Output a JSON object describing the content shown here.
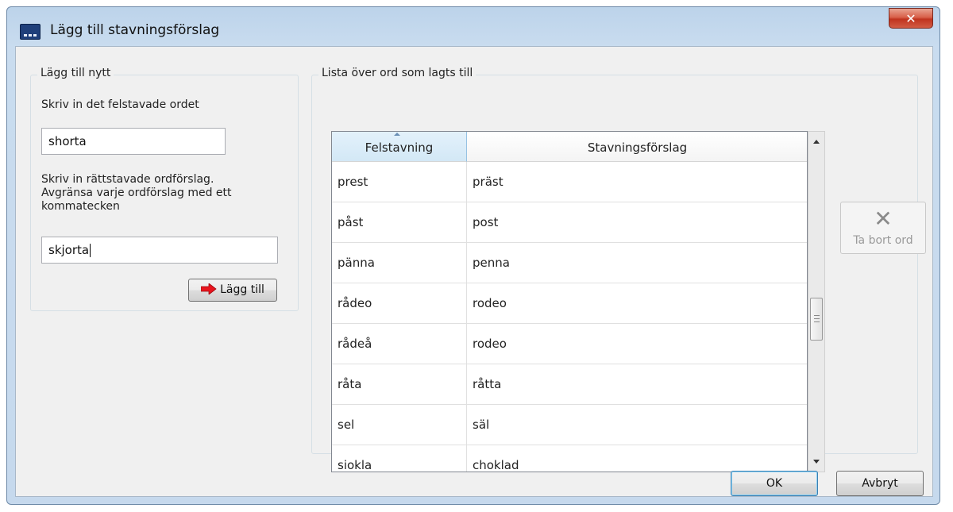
{
  "window": {
    "title": "Lägg till stavningsförslag",
    "close_glyph": "✕",
    "icon": "app-window-icon"
  },
  "add_group": {
    "label": "Lägg till nytt",
    "misspelled_label": "Skriv in det felstavade ordet",
    "misspelled_value": "shorta",
    "suggestions_label_line1": "Skriv in rättstavade ordförslag.",
    "suggestions_label_line2": "Avgränsa varje ordförslag med ett",
    "suggestions_label_line3": "kommatecken",
    "suggestions_value": "skjorta",
    "add_button_label": "Lägg till",
    "add_button_icon": "red-arrow-right-icon",
    "add_button_icon_color": "#e8141d"
  },
  "list_group": {
    "label": "Lista över ord som lagts till",
    "columns": [
      "Felstavning",
      "Stavningsförslag"
    ],
    "rows": [
      [
        "prest",
        "präst"
      ],
      [
        "påst",
        "post"
      ],
      [
        "pänna",
        "penna"
      ],
      [
        "rådeo",
        "rodeo"
      ],
      [
        "rådeå",
        "rodeo"
      ],
      [
        "råta",
        "råtta"
      ],
      [
        "sel",
        "säl"
      ],
      [
        "siokla",
        "choklad"
      ]
    ]
  },
  "remove_button": {
    "label": "Ta bort ord",
    "icon": "x-icon",
    "glyph": "✕"
  },
  "footer": {
    "ok_label": "OK",
    "cancel_label": "Avbryt"
  },
  "colors": {
    "window_frame": "#c6d9ed",
    "client": "#f0f0f0",
    "header_sorted": "#d3e8f6",
    "ok_focus": "#3c7fb1"
  }
}
